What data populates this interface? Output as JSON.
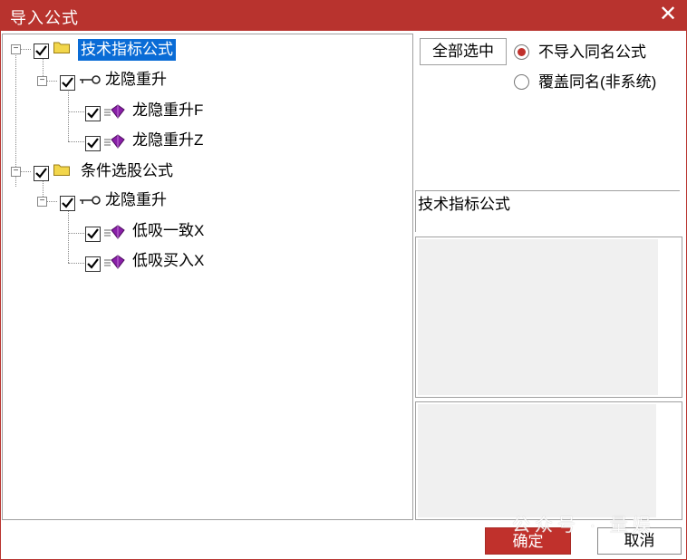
{
  "window": {
    "title": "导入公式",
    "close_glyph": "✕"
  },
  "tree": {
    "groups": [
      {
        "label": "技术指标公式",
        "checked": true,
        "selected": true,
        "icon": "folder-icon",
        "children": [
          {
            "label": "龙隐重升",
            "checked": true,
            "icon": "key-icon",
            "items": [
              {
                "label": "龙隐重升F",
                "checked": true,
                "icon": "gem-icon"
              },
              {
                "label": "龙隐重升Z",
                "checked": true,
                "icon": "gem-icon"
              }
            ]
          }
        ]
      },
      {
        "label": "条件选股公式",
        "checked": true,
        "selected": false,
        "icon": "folder-icon",
        "children": [
          {
            "label": "龙隐重升",
            "checked": true,
            "icon": "key-icon",
            "items": [
              {
                "label": "低吸一致X",
                "checked": true,
                "icon": "gem-icon"
              },
              {
                "label": "低吸买入X",
                "checked": true,
                "icon": "gem-icon"
              }
            ]
          }
        ]
      }
    ]
  },
  "options": {
    "select_all_label": "全部选中",
    "radios": [
      {
        "label": "不导入同名公式",
        "checked": true
      },
      {
        "label": "覆盖同名(非系统)",
        "checked": false
      }
    ]
  },
  "info": {
    "title": "技术指标公式"
  },
  "footer": {
    "ok_label": "确定",
    "cancel_label": "取消"
  },
  "watermark": {
    "text": "公众号 · 量娱"
  },
  "colors": {
    "accent": "#b8332e",
    "selection": "#0a6cd6",
    "gem": "#8a1fa8"
  }
}
